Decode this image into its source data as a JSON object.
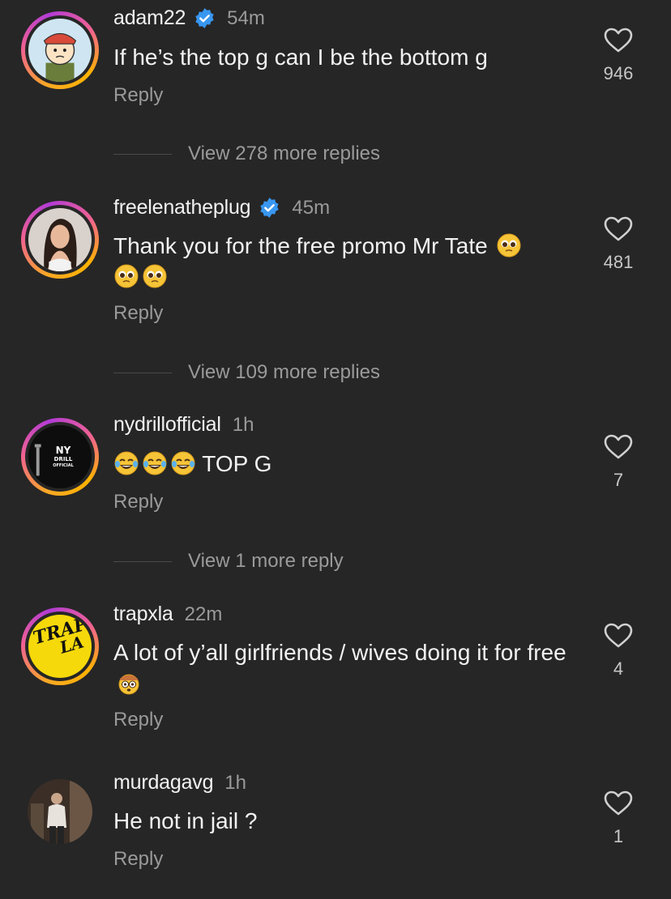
{
  "comments": [
    {
      "username": "adam22",
      "verified": true,
      "time": "54m",
      "text": "If he’s the top g can I be the bottom g",
      "reply_label": "Reply",
      "likes": "946",
      "view_more": "View 278 more replies",
      "avatar_icon": "cartoon-character-avatar"
    },
    {
      "username": "freelenatheplug",
      "verified": true,
      "time": "45m",
      "text": "Thank you for the free promo Mr Tate",
      "emojis": [
        "pleading-face",
        "pleading-face",
        "pleading-face"
      ],
      "reply_label": "Reply",
      "likes": "481",
      "view_more": "View 109 more replies",
      "avatar_icon": "woman-photo-avatar"
    },
    {
      "username": "nydrillofficial",
      "verified": false,
      "time": "1h",
      "text": "TOP G",
      "emojis": [
        "tears-of-joy",
        "tears-of-joy",
        "tears-of-joy"
      ],
      "reply_label": "Reply",
      "likes": "7",
      "view_more": "View 1 more reply",
      "avatar_text": [
        "NY",
        "DRILL",
        "OFFICIAL"
      ]
    },
    {
      "username": "trapxla",
      "verified": false,
      "time": "22m",
      "text": "A lot of y’all girlfriends / wives doing it for free",
      "emojis": [
        "flushed-face-cowboy"
      ],
      "reply_label": "Reply",
      "likes": "4",
      "avatar_text": [
        "TRAP",
        "LA"
      ]
    },
    {
      "username": "murdagavg",
      "verified": false,
      "time": "1h",
      "text": "He not in jail ?",
      "reply_label": "Reply",
      "likes": "1",
      "avatar_icon": "person-photo-avatar"
    }
  ],
  "colors": {
    "background": "#262626",
    "secondary_text": "#9a9a9a",
    "verified_blue": "#3897f0",
    "trap_yellow": "#f5d90a"
  }
}
